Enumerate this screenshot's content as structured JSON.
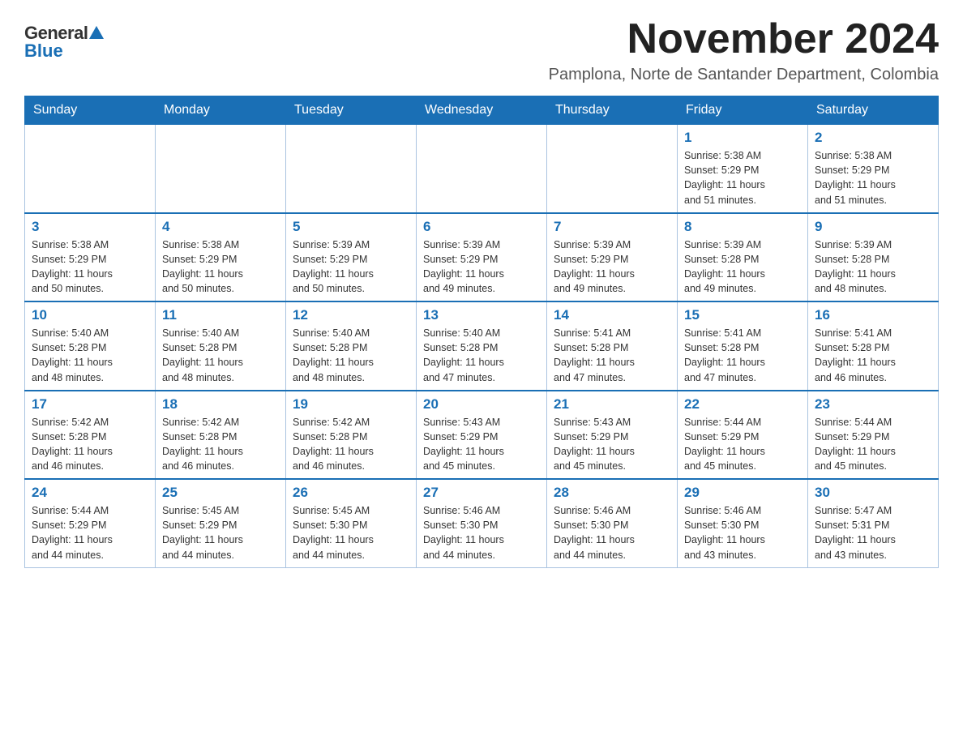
{
  "logo": {
    "text_general": "General",
    "text_blue": "Blue"
  },
  "header": {
    "month_year": "November 2024",
    "location": "Pamplona, Norte de Santander Department, Colombia"
  },
  "weekdays": [
    "Sunday",
    "Monday",
    "Tuesday",
    "Wednesday",
    "Thursday",
    "Friday",
    "Saturday"
  ],
  "weeks": [
    [
      {
        "day": "",
        "info": ""
      },
      {
        "day": "",
        "info": ""
      },
      {
        "day": "",
        "info": ""
      },
      {
        "day": "",
        "info": ""
      },
      {
        "day": "",
        "info": ""
      },
      {
        "day": "1",
        "info": "Sunrise: 5:38 AM\nSunset: 5:29 PM\nDaylight: 11 hours\nand 51 minutes."
      },
      {
        "day": "2",
        "info": "Sunrise: 5:38 AM\nSunset: 5:29 PM\nDaylight: 11 hours\nand 51 minutes."
      }
    ],
    [
      {
        "day": "3",
        "info": "Sunrise: 5:38 AM\nSunset: 5:29 PM\nDaylight: 11 hours\nand 50 minutes."
      },
      {
        "day": "4",
        "info": "Sunrise: 5:38 AM\nSunset: 5:29 PM\nDaylight: 11 hours\nand 50 minutes."
      },
      {
        "day": "5",
        "info": "Sunrise: 5:39 AM\nSunset: 5:29 PM\nDaylight: 11 hours\nand 50 minutes."
      },
      {
        "day": "6",
        "info": "Sunrise: 5:39 AM\nSunset: 5:29 PM\nDaylight: 11 hours\nand 49 minutes."
      },
      {
        "day": "7",
        "info": "Sunrise: 5:39 AM\nSunset: 5:29 PM\nDaylight: 11 hours\nand 49 minutes."
      },
      {
        "day": "8",
        "info": "Sunrise: 5:39 AM\nSunset: 5:28 PM\nDaylight: 11 hours\nand 49 minutes."
      },
      {
        "day": "9",
        "info": "Sunrise: 5:39 AM\nSunset: 5:28 PM\nDaylight: 11 hours\nand 48 minutes."
      }
    ],
    [
      {
        "day": "10",
        "info": "Sunrise: 5:40 AM\nSunset: 5:28 PM\nDaylight: 11 hours\nand 48 minutes."
      },
      {
        "day": "11",
        "info": "Sunrise: 5:40 AM\nSunset: 5:28 PM\nDaylight: 11 hours\nand 48 minutes."
      },
      {
        "day": "12",
        "info": "Sunrise: 5:40 AM\nSunset: 5:28 PM\nDaylight: 11 hours\nand 48 minutes."
      },
      {
        "day": "13",
        "info": "Sunrise: 5:40 AM\nSunset: 5:28 PM\nDaylight: 11 hours\nand 47 minutes."
      },
      {
        "day": "14",
        "info": "Sunrise: 5:41 AM\nSunset: 5:28 PM\nDaylight: 11 hours\nand 47 minutes."
      },
      {
        "day": "15",
        "info": "Sunrise: 5:41 AM\nSunset: 5:28 PM\nDaylight: 11 hours\nand 47 minutes."
      },
      {
        "day": "16",
        "info": "Sunrise: 5:41 AM\nSunset: 5:28 PM\nDaylight: 11 hours\nand 46 minutes."
      }
    ],
    [
      {
        "day": "17",
        "info": "Sunrise: 5:42 AM\nSunset: 5:28 PM\nDaylight: 11 hours\nand 46 minutes."
      },
      {
        "day": "18",
        "info": "Sunrise: 5:42 AM\nSunset: 5:28 PM\nDaylight: 11 hours\nand 46 minutes."
      },
      {
        "day": "19",
        "info": "Sunrise: 5:42 AM\nSunset: 5:28 PM\nDaylight: 11 hours\nand 46 minutes."
      },
      {
        "day": "20",
        "info": "Sunrise: 5:43 AM\nSunset: 5:29 PM\nDaylight: 11 hours\nand 45 minutes."
      },
      {
        "day": "21",
        "info": "Sunrise: 5:43 AM\nSunset: 5:29 PM\nDaylight: 11 hours\nand 45 minutes."
      },
      {
        "day": "22",
        "info": "Sunrise: 5:44 AM\nSunset: 5:29 PM\nDaylight: 11 hours\nand 45 minutes."
      },
      {
        "day": "23",
        "info": "Sunrise: 5:44 AM\nSunset: 5:29 PM\nDaylight: 11 hours\nand 45 minutes."
      }
    ],
    [
      {
        "day": "24",
        "info": "Sunrise: 5:44 AM\nSunset: 5:29 PM\nDaylight: 11 hours\nand 44 minutes."
      },
      {
        "day": "25",
        "info": "Sunrise: 5:45 AM\nSunset: 5:29 PM\nDaylight: 11 hours\nand 44 minutes."
      },
      {
        "day": "26",
        "info": "Sunrise: 5:45 AM\nSunset: 5:30 PM\nDaylight: 11 hours\nand 44 minutes."
      },
      {
        "day": "27",
        "info": "Sunrise: 5:46 AM\nSunset: 5:30 PM\nDaylight: 11 hours\nand 44 minutes."
      },
      {
        "day": "28",
        "info": "Sunrise: 5:46 AM\nSunset: 5:30 PM\nDaylight: 11 hours\nand 44 minutes."
      },
      {
        "day": "29",
        "info": "Sunrise: 5:46 AM\nSunset: 5:30 PM\nDaylight: 11 hours\nand 43 minutes."
      },
      {
        "day": "30",
        "info": "Sunrise: 5:47 AM\nSunset: 5:31 PM\nDaylight: 11 hours\nand 43 minutes."
      }
    ]
  ]
}
